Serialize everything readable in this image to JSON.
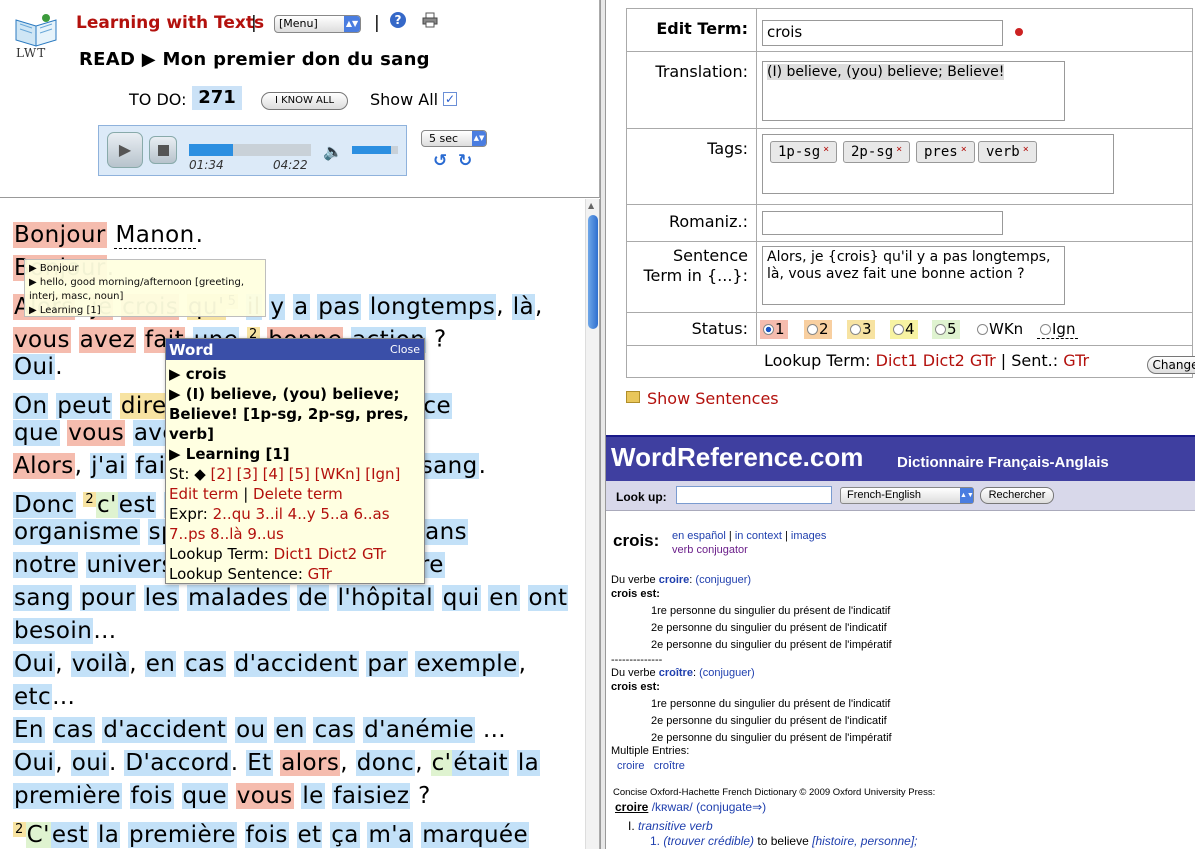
{
  "header": {
    "logo_text": "LWT",
    "app_title": "Learning with Texts",
    "separator": "|",
    "menu_select": "[Menu]",
    "read_title": "READ ▶ Mon premier don du sang",
    "todo_label": "TO DO:",
    "todo_count": "271",
    "i_know_all": "I KNOW ALL",
    "show_all": "Show All"
  },
  "player": {
    "current_time": "01:34",
    "total_time": "04:22",
    "progress": 0.36,
    "volume": 0.85,
    "skip_select": "5 sec"
  },
  "reader": {
    "tooltip_lines": [
      "▶ Bonjour",
      "▶ hello, good morning/afternoon [greeting, interj, masc, noun]",
      "▶ Learning [1]"
    ]
  },
  "popup": {
    "title": "Word",
    "close": "Close",
    "term": "▶ crois",
    "translation": "▶ (I) believe, (you) believe; Believe! [1p-sg, 2p-sg, pres, verb]",
    "status": "▶ Learning [1]",
    "st_label": "St: ◆",
    "st_links": "[2] [3] [4] [5] [WKn] [Ign]",
    "edit_term": "Edit term",
    "delete_term": "Delete term",
    "expr_label": "Expr:",
    "expr_links_1": "2..qu 3..il 4..y 5..a 6..as",
    "expr_links_2": "7..ps 8..là 9..us",
    "lookup_term_label": "Lookup Term:",
    "lookup_term_links": "Dict1 Dict2 GTr",
    "lookup_sentence_label": "Lookup Sentence:",
    "lookup_sentence_link": "GTr"
  },
  "edit": {
    "edit_term_label": "Edit Term:",
    "term_value": "crois",
    "translation_label": "Translation:",
    "translation_value": "(I) believe, (you) believe; Believe!",
    "tags_label": "Tags:",
    "tags": [
      "1p-sg",
      "2p-sg",
      "pres",
      "verb"
    ],
    "tag_remove": "×",
    "romaniz_label": "Romaniz.:",
    "sentence_label_1": "Sentence",
    "sentence_label_2": "Term in {...}:",
    "sentence_value": "Alors, je {crois} qu'il y a pas longtemps, là, vous avez fait une bonne action ?",
    "status_label": "Status:",
    "status_options": [
      "1",
      "2",
      "3",
      "4",
      "5",
      "WKn",
      "Ign"
    ],
    "lookup_term_label": "Lookup Term:",
    "dict1": "Dict1",
    "dict2": "Dict2",
    "gtr": "GTr",
    "sent_label": "| Sent.:",
    "sent_gtr": "GTr",
    "change_button": "Change",
    "show_sentences": "Show Sentences"
  },
  "wordref": {
    "brand": "WordReference.com",
    "subtitle": "Dictionnaire Français-Anglais",
    "lookup_label": "Look up:",
    "lang_select": "French-English",
    "search_button": "Rechercher",
    "headword": "crois:",
    "link_es": "en español",
    "link_ctx": "in context",
    "link_img": "images",
    "verb_conj": "verb conjugator",
    "du_verbe_1": "Du verbe",
    "croire": "croire",
    "conjuguer": "(conjuguer)",
    "crois_est": "crois est:",
    "croire_rows": [
      "1re personne du singulier du présent de l'indicatif",
      "2e personne du singulier du présent de l'indicatif",
      "2e personne du singulier du présent de l'impératif"
    ],
    "dash": "--------------",
    "croitre": "croître",
    "croitre_rows": [
      "1re personne du singulier du présent de l'indicatif",
      "2e personne du singulier du présent de l'indicatif",
      "2e personne du singulier du présent de l'impératif"
    ],
    "multiple": "Multiple Entries:",
    "multi_croire": "croire",
    "multi_croitre": "croître",
    "concise": "Concise Oxford-Hachette French Dictionary © 2009 Oxford University Press:",
    "entry_word": "croire",
    "entry_pron": "/kʀwaʀ/",
    "entry_conj": "(conjugate⇒)",
    "sense_1": "I.",
    "sense_1_txt": "transitive verb",
    "sense_1_1": "1.",
    "sense_1_1_a": "(trouver crédible)",
    "sense_1_1_b": "to believe",
    "sense_1_1_c": "[histoire, personne];"
  }
}
